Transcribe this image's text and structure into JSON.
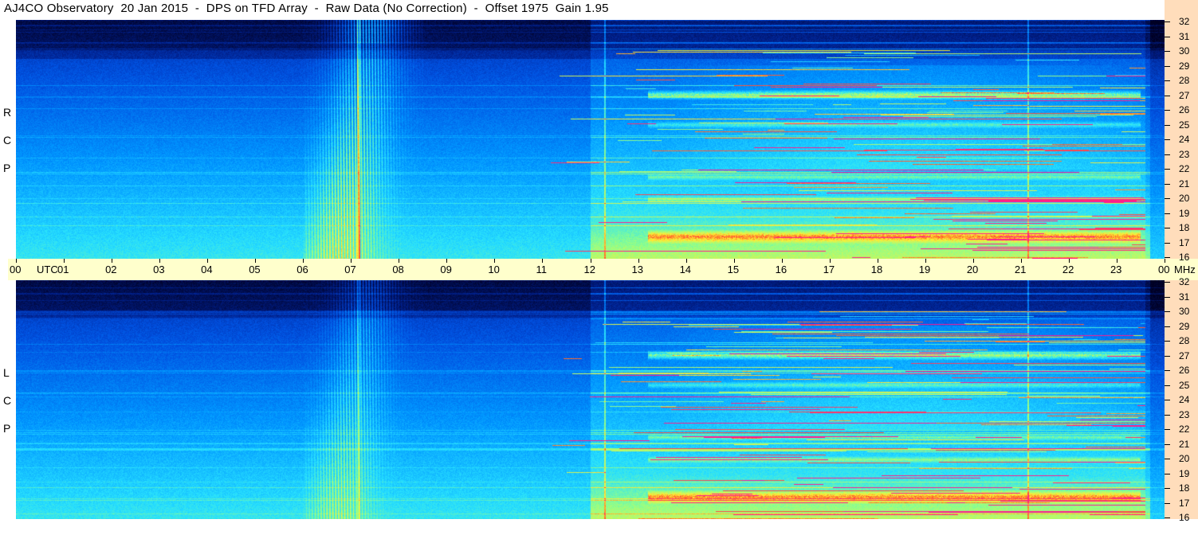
{
  "title": "AJ4CO Observatory  20 Jan 2015  -  DPS on TFD Array  -  Raw Data (No Correction)  -  Offset 1975  Gain 1.95",
  "chart_data": {
    "type": "heatmap",
    "colormap": [
      "#000022",
      "#001f8a",
      "#0050e0",
      "#0096ff",
      "#27e0ff",
      "#8dff8c",
      "#ffee33",
      "#ff5a2a",
      "#ff1a90"
    ],
    "x_axis": {
      "label": "UTC",
      "ticks": [
        "00",
        "01",
        "02",
        "03",
        "04",
        "05",
        "06",
        "07",
        "08",
        "09",
        "10",
        "11",
        "12",
        "13",
        "14",
        "15",
        "16",
        "17",
        "18",
        "19",
        "20",
        "21",
        "22",
        "23",
        "00"
      ],
      "range_hours": [
        0,
        24
      ]
    },
    "y_axis": {
      "label": "MHz",
      "range": [
        16,
        32
      ],
      "ticks": [
        "32",
        "31",
        "30",
        "29",
        "28",
        "27",
        "26",
        "25",
        "24",
        "23",
        "22",
        "21",
        "20",
        "19",
        "18",
        "17",
        "16"
      ]
    },
    "panels": [
      {
        "name": "R C P",
        "polarization": "RCP"
      },
      {
        "name": "L C P",
        "polarization": "LCP"
      }
    ],
    "features": {
      "solar_burst_utc": [
        6.0,
        8.5
      ],
      "night_rfi_band_mhz": [
        27,
        17.5,
        21.5,
        25,
        20
      ],
      "vertical_streak_utc": [
        12.3,
        21.15
      ],
      "dark_top_mhz": 30
    }
  }
}
